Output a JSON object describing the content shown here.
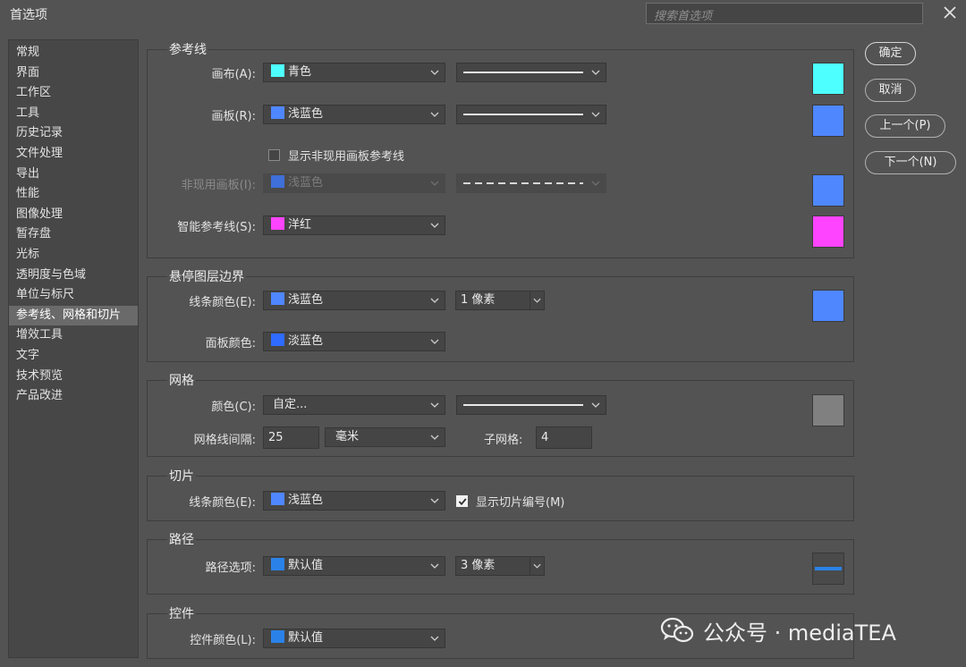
{
  "window": {
    "title": "首选项",
    "search_placeholder": "搜索首选项"
  },
  "sidebar": {
    "items": [
      "常规",
      "界面",
      "工作区",
      "工具",
      "历史记录",
      "文件处理",
      "导出",
      "性能",
      "图像处理",
      "暂存盘",
      "光标",
      "透明度与色域",
      "单位与标尺",
      "参考线、网格和切片",
      "增效工具",
      "文字",
      "技术预览",
      "产品改进"
    ],
    "active_index": 13
  },
  "buttons": {
    "ok": "确定",
    "cancel": "取消",
    "prev": "上一个(P)",
    "next": "下一个(N)"
  },
  "guides": {
    "title": "参考线",
    "canvas": {
      "label": "画布(A):",
      "color_name": "青色",
      "color": "#4effff",
      "line_style": "solid"
    },
    "artboard": {
      "label": "画板(R):",
      "color_name": "浅蓝色",
      "color": "#4f87ff",
      "line_style": "solid"
    },
    "show_inactive_label": "显示非现用画板参考线",
    "show_inactive_checked": false,
    "inactive_artboard": {
      "label": "非现用画板(I):",
      "color_name": "浅蓝色",
      "color": "#4f87ff",
      "line_style": "dashed"
    },
    "smart": {
      "label": "智能参考线(S):",
      "color_name": "洋红",
      "color": "#ff44ff"
    }
  },
  "hover_layer": {
    "title": "悬停图层边界",
    "line_color": {
      "label": "线条颜色(E):",
      "color_name": "浅蓝色",
      "color": "#4f87ff",
      "width": "1 像素"
    },
    "panel_color": {
      "label": "面板颜色:",
      "color_name": "淡蓝色",
      "color": "#2f6bff"
    }
  },
  "grid": {
    "title": "网格",
    "color": {
      "label": "颜色(C):",
      "value": "自定...",
      "swatch": "#808080",
      "line_style": "solid"
    },
    "gridline_every": {
      "label": "网格线间隔:",
      "value": "25",
      "unit": "毫米"
    },
    "subdivisions": {
      "label": "子网格:",
      "value": "4"
    }
  },
  "slices": {
    "title": "切片",
    "line_color": {
      "label": "线条颜色(E):",
      "color_name": "浅蓝色",
      "color": "#4f87ff"
    },
    "show_numbers_label": "显示切片编号(M)",
    "show_numbers_checked": true
  },
  "paths": {
    "title": "路径",
    "options": {
      "label": "路径选项:",
      "value": "默认值",
      "color": "#2a82e8",
      "width": "3 像素"
    }
  },
  "controls": {
    "title": "控件",
    "color": {
      "label": "控件颜色(L):",
      "value": "默认值",
      "color": "#2a82e8"
    }
  },
  "watermark": {
    "text": "公众号 · mediaTEA"
  }
}
